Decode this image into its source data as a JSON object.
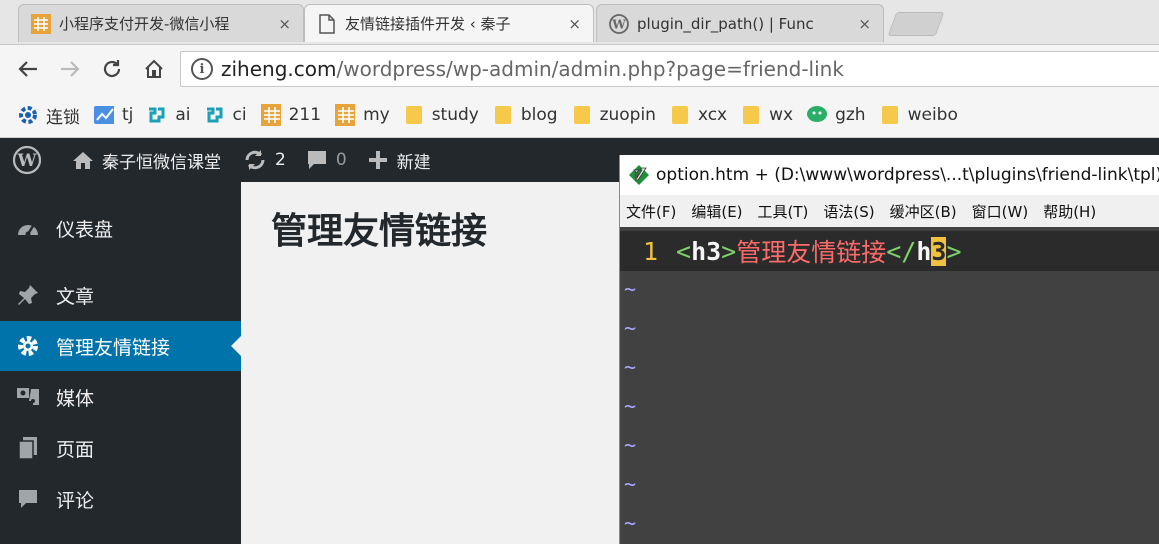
{
  "browser": {
    "tabs": [
      {
        "title": "小程序支付开发-微信小程",
        "close": "×"
      },
      {
        "title": "友情链接插件开发 ‹ 秦子",
        "close": "×"
      },
      {
        "title": "plugin_dir_path() | Func",
        "close": "×"
      }
    ],
    "url_host": "ziheng.com",
    "url_path": "/wordpress/wp-admin/admin.php?page=friend-link",
    "bookmarks": [
      {
        "label": "连锁",
        "icon": "gear-icon"
      },
      {
        "label": "tj",
        "icon": "chart-icon"
      },
      {
        "label": "ai",
        "icon": "plugin-icon"
      },
      {
        "label": "ci",
        "icon": "plugin-icon"
      },
      {
        "label": "211",
        "icon": "site-logo-icon"
      },
      {
        "label": "my",
        "icon": "site-logo-icon"
      },
      {
        "label": "study",
        "icon": "folder-icon"
      },
      {
        "label": "blog",
        "icon": "folder-icon"
      },
      {
        "label": "zuopin",
        "icon": "folder-icon"
      },
      {
        "label": "xcx",
        "icon": "folder-icon"
      },
      {
        "label": "wx",
        "icon": "folder-icon"
      },
      {
        "label": "gzh",
        "icon": "wechat-icon"
      },
      {
        "label": "weibo",
        "icon": "folder-icon"
      }
    ]
  },
  "adminbar": {
    "site_name": "秦子恒微信课堂",
    "updates_count": "2",
    "comments_count": "0",
    "new_label": "新建"
  },
  "sidebar": {
    "items": [
      {
        "label": "仪表盘",
        "icon": "dashboard-icon"
      },
      {
        "label": "文章",
        "icon": "pin-icon"
      },
      {
        "label": "管理友情链接",
        "icon": "gear-icon"
      },
      {
        "label": "媒体",
        "icon": "media-icon"
      },
      {
        "label": "页面",
        "icon": "page-icon"
      },
      {
        "label": "评论",
        "icon": "comment-icon"
      }
    ]
  },
  "content": {
    "heading": "管理友情链接"
  },
  "vim": {
    "title": "option.htm + (D:\\www\\wordpress\\...t\\plugins\\friend-link\\tpl)",
    "menu": [
      "文件(F)",
      "编辑(E)",
      "工具(T)",
      "语法(S)",
      "缓冲区(B)",
      "窗口(W)",
      "帮助(H)"
    ],
    "line_number": "1",
    "code": {
      "open_bracket": "<",
      "open_tag": "h3",
      "close_bracket": ">",
      "text": "管理友情链接",
      "end_open": "</",
      "end_tag": "h",
      "cursor_char": "3",
      "end_close": ">"
    },
    "tilde": "~"
  }
}
